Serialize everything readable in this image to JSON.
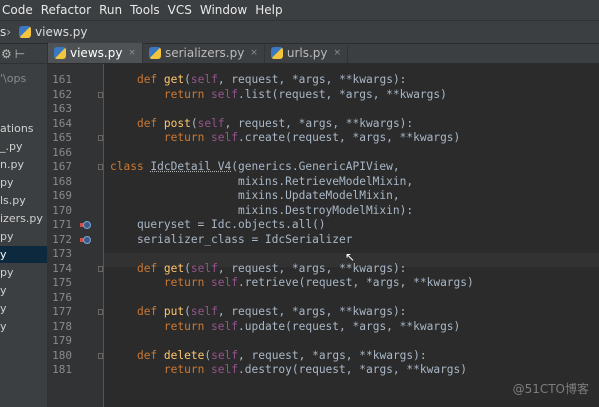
{
  "menu": [
    "Code",
    "Refactor",
    "Run",
    "Tools",
    "VCS",
    "Window",
    "Help"
  ],
  "navbar": {
    "left_crumb": "s",
    "file": "views.py"
  },
  "sidebar": {
    "toolbar_icons": [
      "⚙",
      "⊢"
    ],
    "path_label": "'\\ops",
    "items": [
      {
        "label": "ations",
        "selected": false,
        "muted": false
      },
      {
        "label": "_.py",
        "selected": false,
        "muted": false
      },
      {
        "label": "n.py",
        "selected": false,
        "muted": false
      },
      {
        "label": "py",
        "selected": false,
        "muted": false
      },
      {
        "label": "ls.py",
        "selected": false,
        "muted": false
      },
      {
        "label": "izers.py",
        "selected": false,
        "muted": false
      },
      {
        "label": "py",
        "selected": false,
        "muted": false
      },
      {
        "label": "y",
        "selected": true,
        "muted": false
      },
      {
        "label": "py",
        "selected": false,
        "muted": false
      },
      {
        "label": "y",
        "selected": false,
        "muted": false
      },
      {
        "label": "y",
        "selected": false,
        "muted": false
      },
      {
        "label": "y",
        "selected": false,
        "muted": false
      }
    ]
  },
  "tabs": [
    {
      "label": "views.py",
      "active": true
    },
    {
      "label": "serializers.py",
      "active": false
    },
    {
      "label": "urls.py",
      "active": false
    }
  ],
  "tab_close": "×",
  "lines": [
    {
      "n": "161",
      "mark": false
    },
    {
      "n": "162",
      "mark": false
    },
    {
      "n": "163",
      "mark": false
    },
    {
      "n": "164",
      "mark": false
    },
    {
      "n": "165",
      "mark": false
    },
    {
      "n": "166",
      "mark": false
    },
    {
      "n": "167",
      "mark": false
    },
    {
      "n": "168",
      "mark": false
    },
    {
      "n": "169",
      "mark": false
    },
    {
      "n": "170",
      "mark": false
    },
    {
      "n": "171",
      "mark": true
    },
    {
      "n": "172",
      "mark": true
    },
    {
      "n": "173",
      "mark": false
    },
    {
      "n": "174",
      "mark": false
    },
    {
      "n": "175",
      "mark": false
    },
    {
      "n": "176",
      "mark": false
    },
    {
      "n": "177",
      "mark": false
    },
    {
      "n": "178",
      "mark": false
    },
    {
      "n": "179",
      "mark": false
    },
    {
      "n": "180",
      "mark": false
    },
    {
      "n": "181",
      "mark": false
    }
  ],
  "code": {
    "l161": [
      [
        "    ",
        ""
      ],
      [
        "def ",
        "kw"
      ],
      [
        "get",
        "fn"
      ],
      [
        "(",
        ""
      ],
      [
        "self",
        "self"
      ],
      [
        ", request, *args, **kwargs):",
        ""
      ]
    ],
    "l162": [
      [
        "        ",
        ""
      ],
      [
        "return ",
        "kw"
      ],
      [
        "self",
        "self"
      ],
      [
        ".list(request, *args, **kwargs)",
        ""
      ]
    ],
    "l163": [
      [
        "",
        ""
      ]
    ],
    "l164": [
      [
        "    ",
        ""
      ],
      [
        "def ",
        "kw"
      ],
      [
        "post",
        "fn"
      ],
      [
        "(",
        ""
      ],
      [
        "self",
        "self"
      ],
      [
        ", request, *args, **kwargs):",
        ""
      ]
    ],
    "l165": [
      [
        "        ",
        ""
      ],
      [
        "return ",
        "kw"
      ],
      [
        "self",
        "self"
      ],
      [
        ".create(request, *args, **kwargs)",
        ""
      ]
    ],
    "l166": [
      [
        "",
        ""
      ]
    ],
    "l167": [
      [
        "class ",
        "kw"
      ],
      [
        "IdcDetail V4",
        "under"
      ],
      [
        "(generics.GenericAPIView,",
        ""
      ]
    ],
    "l168": [
      [
        "                   mixins.RetrieveModelMixin,",
        ""
      ]
    ],
    "l169": [
      [
        "                   mixins.UpdateModelMixin,",
        ""
      ]
    ],
    "l170": [
      [
        "                   mixins.DestroyModelMixin):",
        ""
      ]
    ],
    "l171": [
      [
        "    queryset = Idc.objects.all()",
        ""
      ]
    ],
    "l172": [
      [
        "    serializer_class = IdcSerializer",
        ""
      ]
    ],
    "l173": [
      [
        "",
        ""
      ]
    ],
    "l174": [
      [
        "    ",
        ""
      ],
      [
        "def ",
        "kw"
      ],
      [
        "get",
        "fn"
      ],
      [
        "(",
        ""
      ],
      [
        "self",
        "self"
      ],
      [
        ", request, *args, **kwargs):",
        ""
      ]
    ],
    "l175": [
      [
        "        ",
        ""
      ],
      [
        "return ",
        "kw"
      ],
      [
        "self",
        "self"
      ],
      [
        ".retrieve(request, *args, **kwargs)",
        ""
      ]
    ],
    "l176": [
      [
        "",
        ""
      ]
    ],
    "l177": [
      [
        "    ",
        ""
      ],
      [
        "def ",
        "kw"
      ],
      [
        "put",
        "fn"
      ],
      [
        "(",
        ""
      ],
      [
        "self",
        "self"
      ],
      [
        ", request, *args, **kwargs):",
        ""
      ]
    ],
    "l178": [
      [
        "        ",
        ""
      ],
      [
        "return ",
        "kw"
      ],
      [
        "self",
        "self"
      ],
      [
        ".update(request, *args, **kwargs)",
        ""
      ]
    ],
    "l179": [
      [
        "",
        ""
      ]
    ],
    "l180": [
      [
        "    ",
        ""
      ],
      [
        "def ",
        "kw"
      ],
      [
        "delete",
        "fn"
      ],
      [
        "(",
        ""
      ],
      [
        "self",
        "self"
      ],
      [
        ", request, *args, **kwargs):",
        ""
      ]
    ],
    "l181": [
      [
        "        ",
        ""
      ],
      [
        "return ",
        "kw"
      ],
      [
        "self",
        "self"
      ],
      [
        ".destroy(request, *args, **kwargs)",
        ""
      ]
    ]
  },
  "watermark": "@51CTO博客",
  "colors": {
    "keyword": "#cc7832",
    "self": "#94558d",
    "function": "#ffc66d",
    "text": "#a9b7c6",
    "background": "#2b2b2b"
  }
}
